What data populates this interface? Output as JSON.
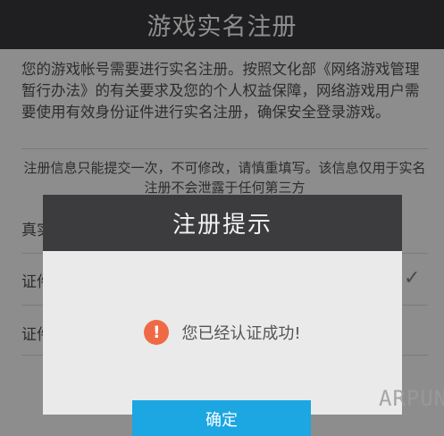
{
  "header": {
    "title": "游戏实名注册"
  },
  "form": {
    "intro": "您的游戏帐号需要进行实名注册。按照文化部《网络游戏管理暂行办法》的有关要求及您的个人权益保障，网络游戏用户需要使用有效身份证件进行实名注册，确保安全登录游戏。",
    "notice": "注册信息只能提交一次，不可修改，请慎重填写。该信息仅用于实名注册不会泄露于任何第三方",
    "rows": [
      {
        "label": "真实"
      },
      {
        "label": "证件"
      },
      {
        "label": "证件"
      }
    ]
  },
  "dialog": {
    "title": "注册提示",
    "icon": "warning-icon",
    "message": "您已经认证成功!",
    "confirm_label": "确定",
    "accent": "#1ca6e2",
    "icon_color": "#ef6a44"
  },
  "watermark": {
    "text": "ARPUN"
  }
}
